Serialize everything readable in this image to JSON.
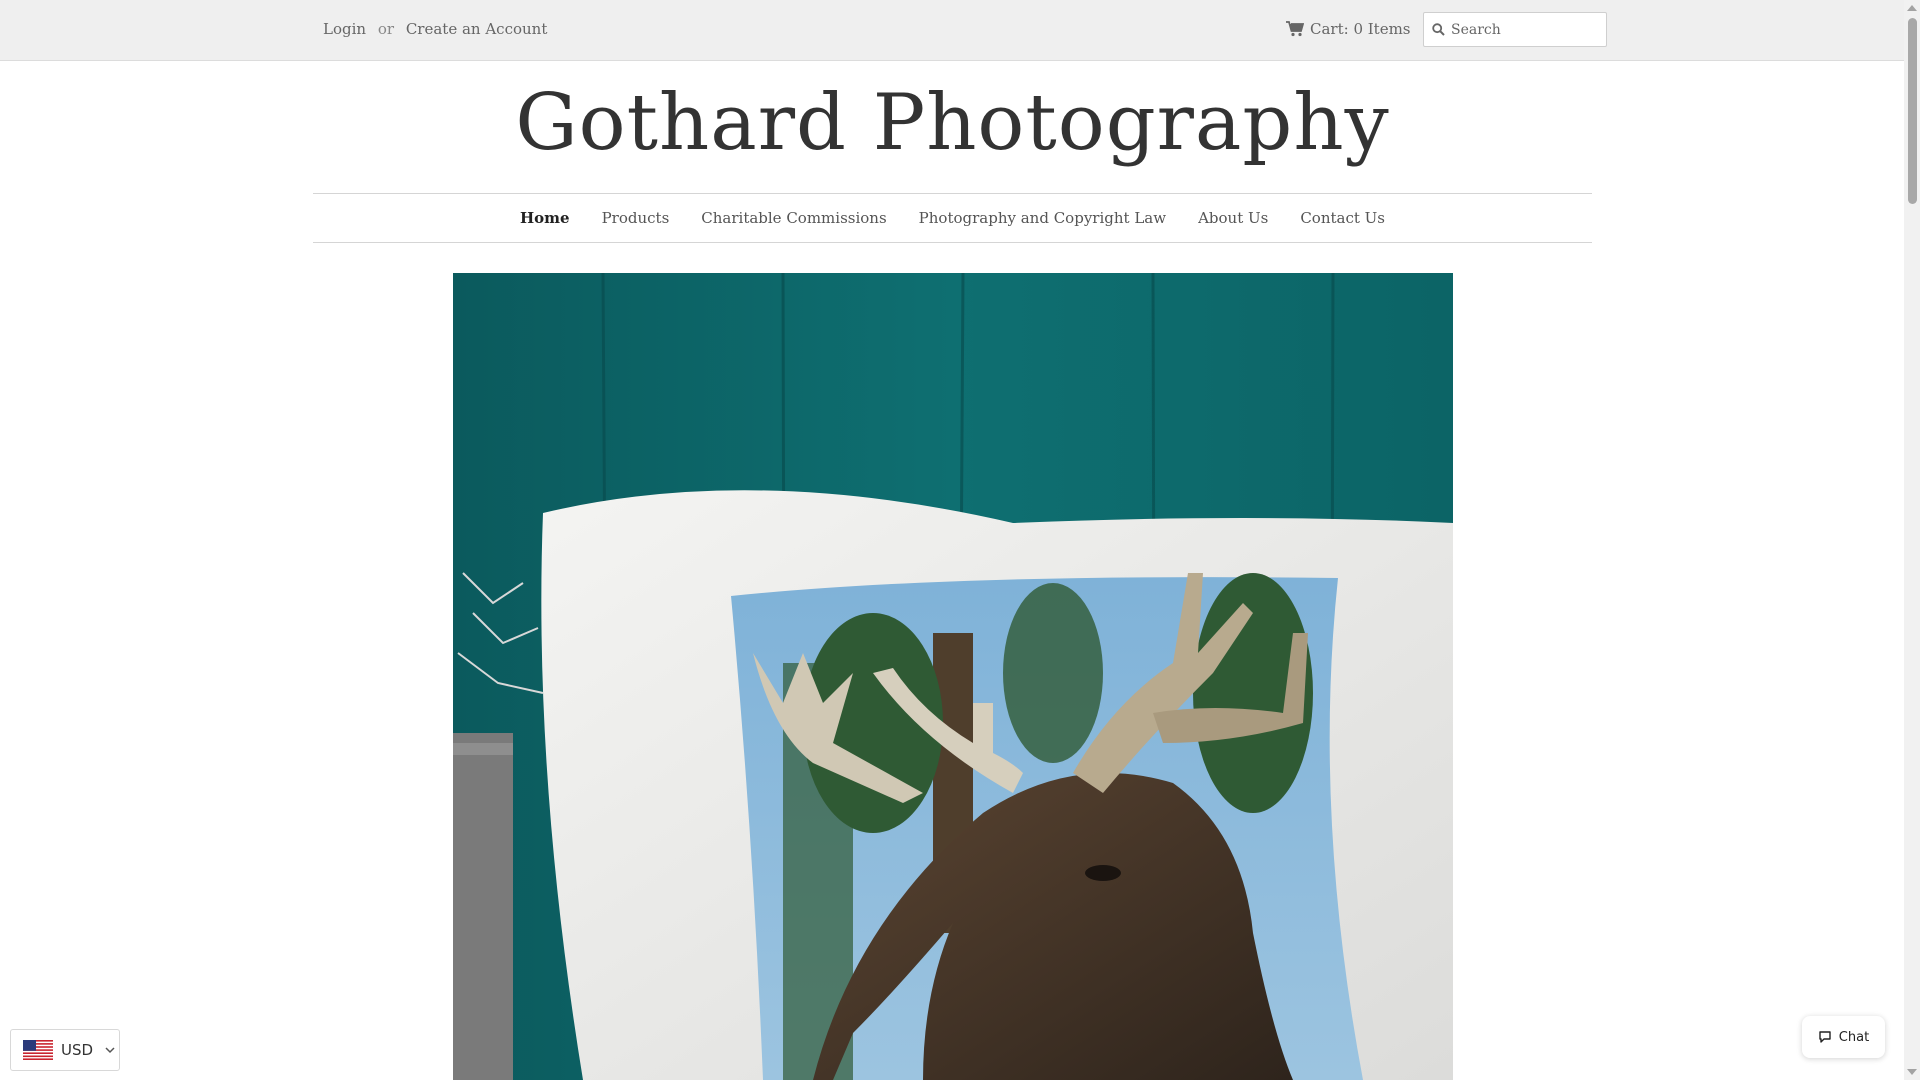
{
  "account": {
    "login": "Login",
    "separator": "or",
    "create_account": "Create an Account"
  },
  "cart": {
    "icon": "cart-icon",
    "label": "Cart: 0 Items"
  },
  "search": {
    "icon": "search-icon",
    "placeholder": "Search"
  },
  "site": {
    "title": "Gothard Photography"
  },
  "nav": {
    "items": [
      {
        "label": "Home",
        "active": true
      },
      {
        "label": "Products"
      },
      {
        "label": "Charitable Commissions"
      },
      {
        "label": "Photography and Copyright Law"
      },
      {
        "label": "About Us"
      },
      {
        "label": "Contact Us"
      }
    ]
  },
  "hero": {
    "image": "moose-pillow-photo"
  },
  "currency": {
    "icon": "us-flag-icon",
    "code": "USD"
  },
  "chat": {
    "icon": "chat-bubble-icon",
    "label": "Chat"
  },
  "colors": {
    "topbar_bg": "#efefef",
    "text": "#555555",
    "logo": "#333333",
    "hero_bg": "#0d6a6c"
  }
}
